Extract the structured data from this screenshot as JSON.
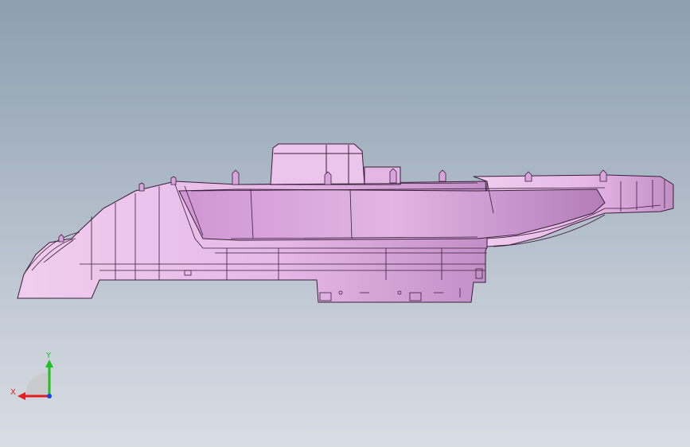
{
  "viewport": {
    "model": "cad-part-side-view",
    "background_top": "#8d9fb0",
    "background_bottom": "#d8dde4"
  },
  "part": {
    "fill_color": "#e7bde7",
    "shade_color": "#c890cc",
    "edge_color": "#3a1e3a"
  },
  "triad": {
    "x_label": "X",
    "y_label": "Y",
    "x_color": "#e02020",
    "y_color": "#20c020",
    "z_color": "#2040e0"
  }
}
